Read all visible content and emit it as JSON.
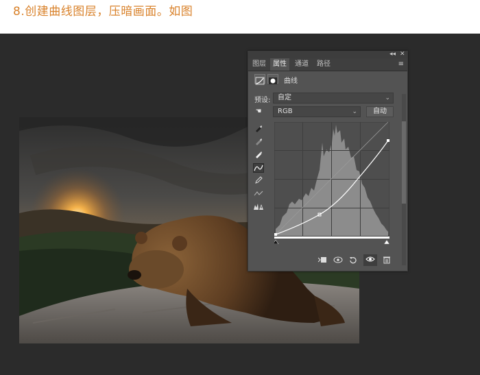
{
  "caption": "8.创建曲线图层，压暗画面。如图",
  "panel": {
    "collapse": "◂◂",
    "close": "✕",
    "tabs": [
      {
        "label": "图层",
        "active": false
      },
      {
        "label": "属性",
        "active": true
      },
      {
        "label": "通道",
        "active": false
      },
      {
        "label": "路径",
        "active": false
      }
    ],
    "menu": "≡",
    "adjustment_title": "曲线",
    "preset_label": "预设:",
    "preset_value": "自定",
    "channel_value": "RGB",
    "auto_button": "自动",
    "colors": {
      "panel_bg": "#535353",
      "graph_bg": "#4e4e4e",
      "histogram": "#8c8c8c",
      "curve": "#ffffff"
    }
  },
  "tools": [
    "black-point-eyedropper-icon",
    "gray-point-eyedropper-icon",
    "white-point-eyedropper-icon",
    "curve-edit-icon",
    "pencil-icon",
    "smooth-icon",
    "clipping-warning-icon"
  ],
  "bottom_bar": {
    "icons": [
      "clip-to-layer-icon",
      "view-previous-icon",
      "reset-icon",
      "visibility-eye-icon",
      "trash-icon"
    ]
  }
}
